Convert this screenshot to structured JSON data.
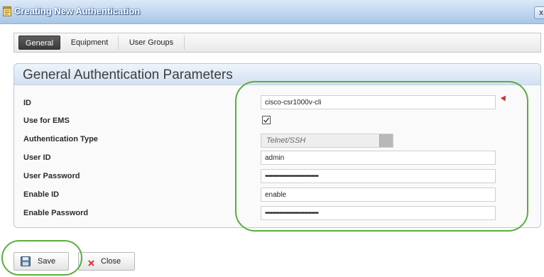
{
  "window": {
    "title": "Creating New Authentication",
    "close_label": "x"
  },
  "tabs": [
    {
      "label": "General",
      "active": true
    },
    {
      "label": "Equipment",
      "active": false
    },
    {
      "label": "User Groups",
      "active": false
    }
  ],
  "panel": {
    "title": "General Authentication Parameters",
    "fields": {
      "id": {
        "label": "ID",
        "value": "cisco-csr1000v-cli",
        "required": true
      },
      "use_for_ems": {
        "label": "Use for EMS",
        "checked": true
      },
      "auth_type": {
        "label": "Authentication Type",
        "value": "Telnet/SSH",
        "disabled": true
      },
      "user_id": {
        "label": "User ID",
        "value": "admin"
      },
      "user_password": {
        "label": "User Password",
        "value": "••••••••••••••••••••••••••••••"
      },
      "enable_id": {
        "label": "Enable ID",
        "value": "enable"
      },
      "enable_password": {
        "label": "Enable Password",
        "value": "••••••••••••••••••••••••••••••"
      }
    }
  },
  "buttons": {
    "save": "Save",
    "close": "Close"
  },
  "icons": {
    "title": "notepad-icon",
    "close": "close-icon",
    "required": "required-pin-icon",
    "save": "floppy-disk-icon",
    "cancel": "red-x-icon"
  },
  "colors": {
    "titlebar": "#bfd6ef",
    "active_tab": "#3f3f3f",
    "panel_header": "#d3e1f1",
    "highlight_outline": "#5aae3c",
    "required_marker": "#d63030"
  }
}
